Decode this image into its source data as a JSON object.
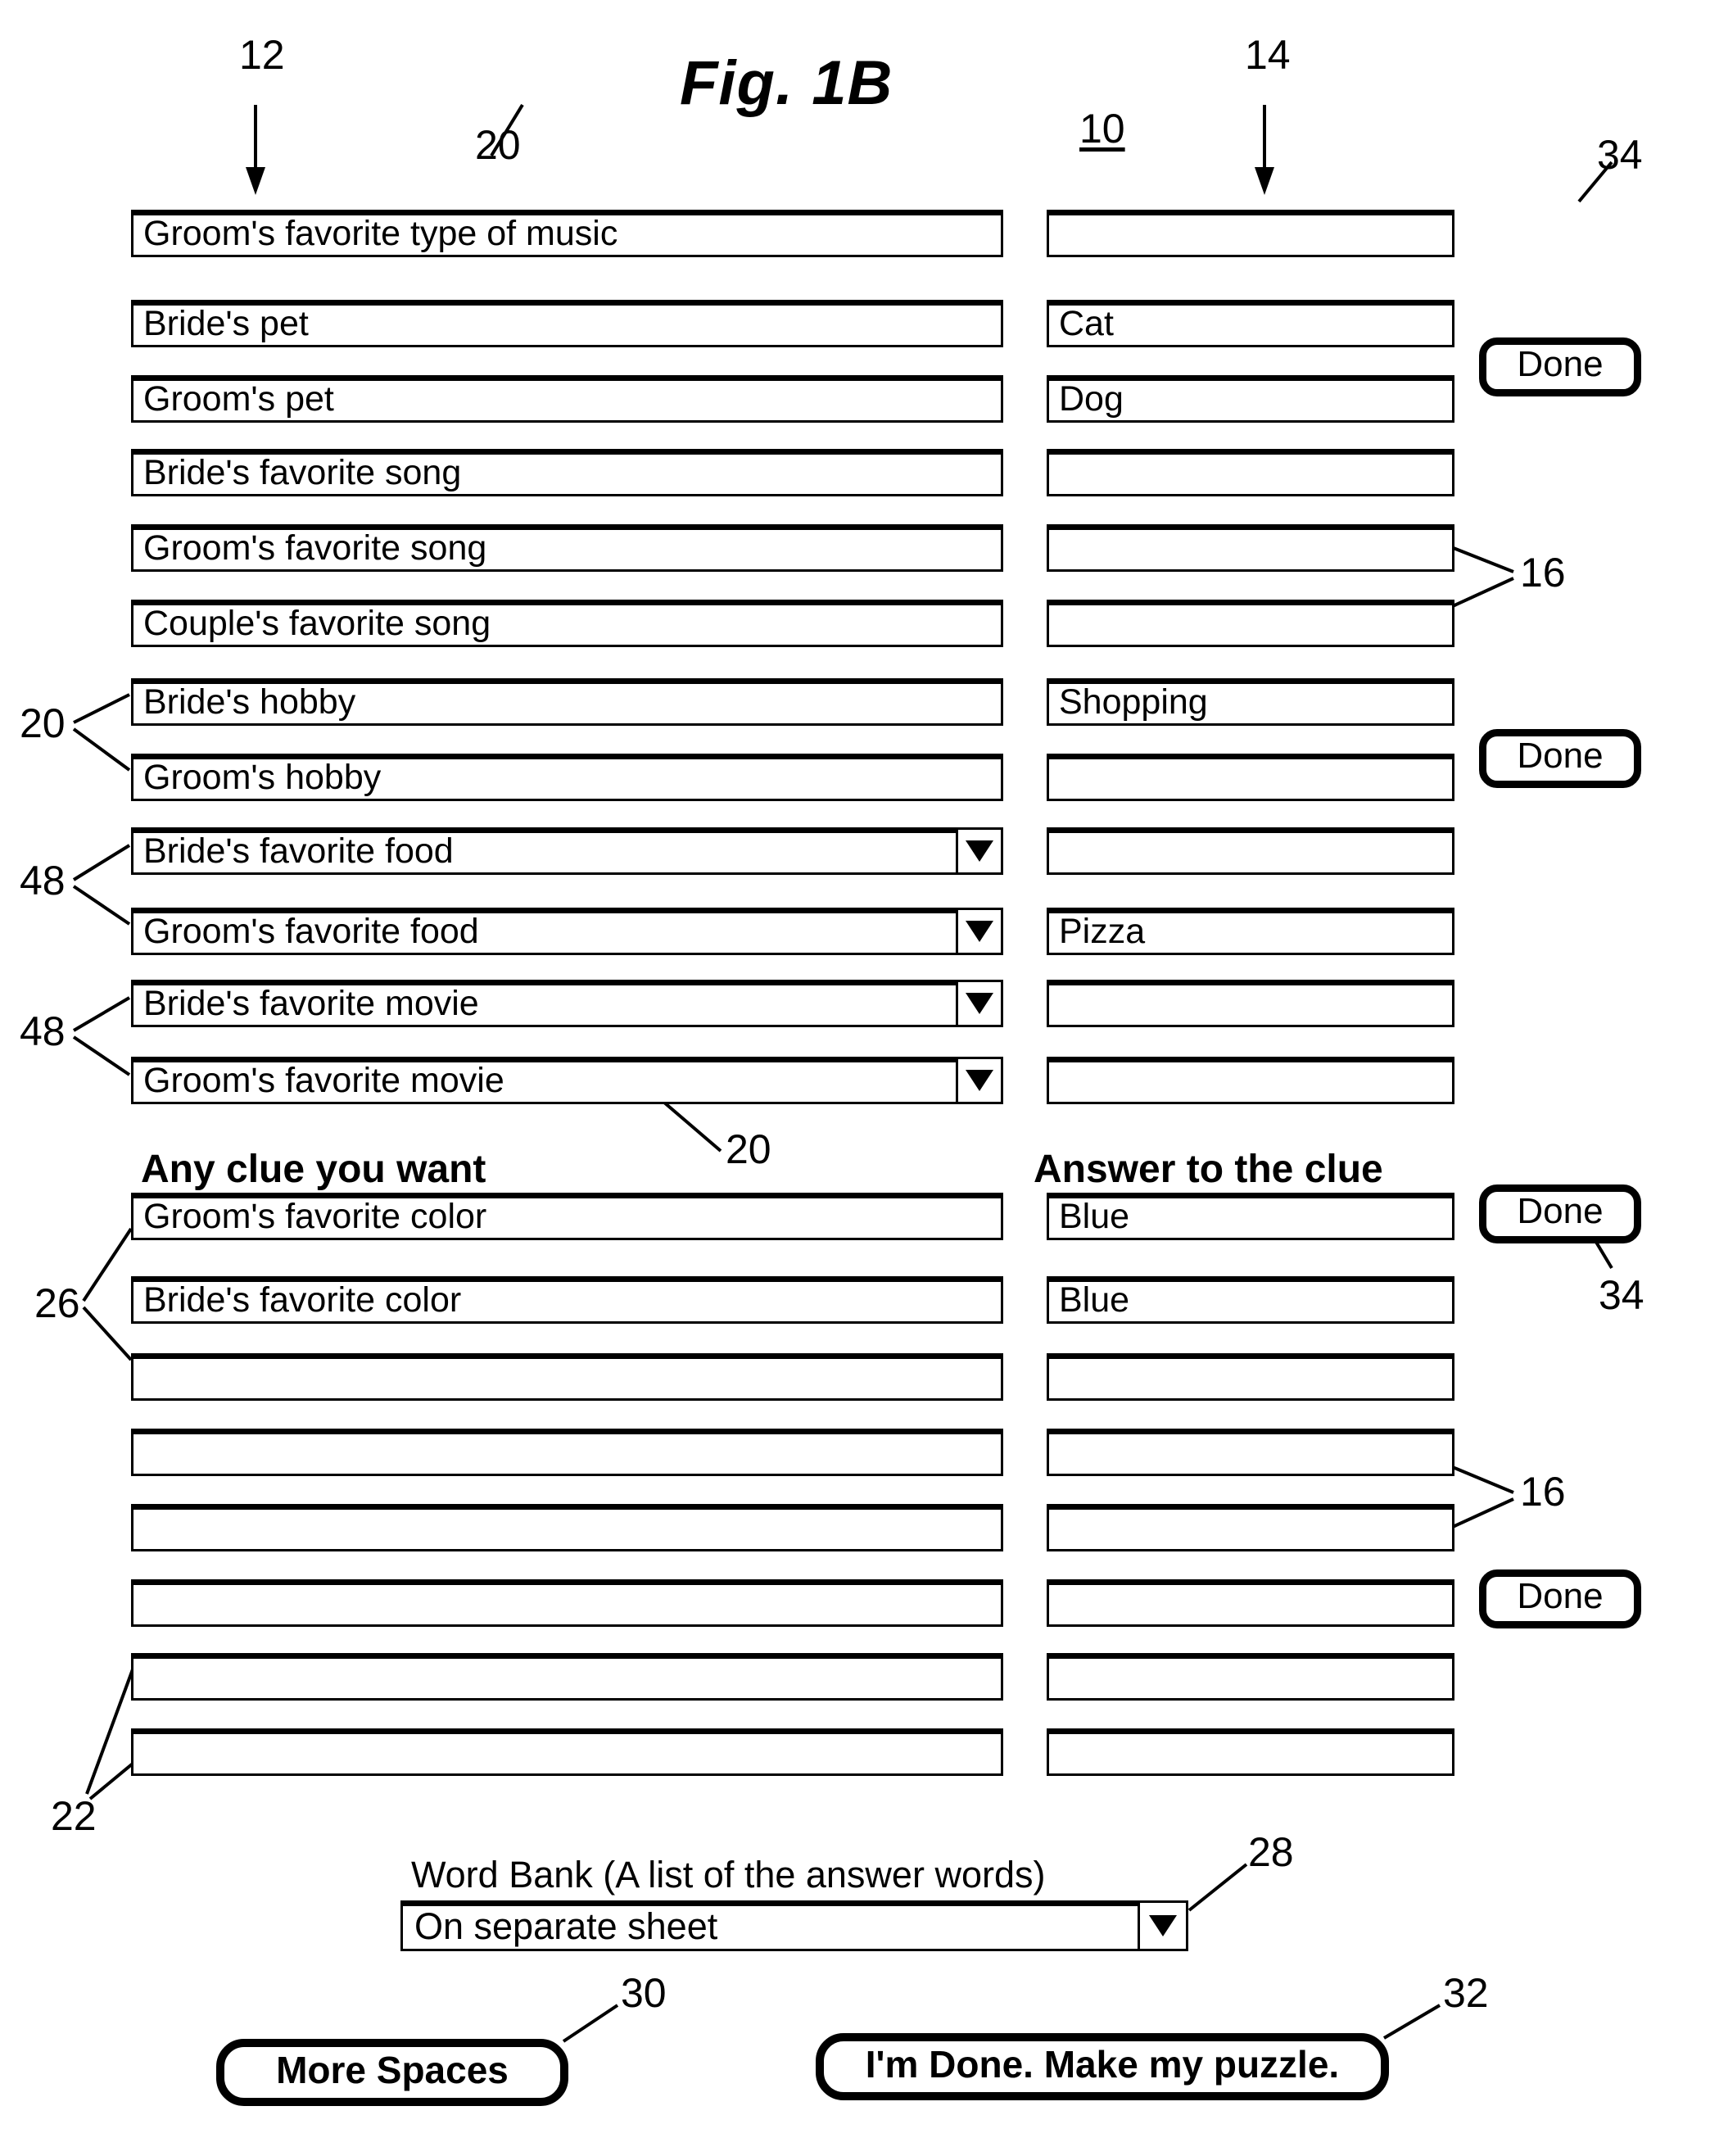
{
  "figure": {
    "title": "Fig. 1B"
  },
  "reference_numerals": {
    "n10": "10",
    "n12": "12",
    "n14": "14",
    "n16_a": "16",
    "n16_b": "16",
    "n20_a": "20",
    "n20_b": "20",
    "n20_c": "20",
    "n22": "22",
    "n26": "26",
    "n28": "28",
    "n30": "30",
    "n32": "32",
    "n34_a": "34",
    "n34_b": "34",
    "n48_a": "48",
    "n48_b": "48"
  },
  "section_headings": {
    "clue_column": "Any clue you want",
    "answer_column": "Answer to the clue"
  },
  "rows": [
    {
      "clue": "Groom's favorite type of music",
      "answer": "",
      "dropdown": false
    },
    {
      "clue": "Bride's pet",
      "answer": "Cat",
      "dropdown": false
    },
    {
      "clue": "Groom's pet",
      "answer": "Dog",
      "dropdown": false
    },
    {
      "clue": "Bride's favorite song",
      "answer": "",
      "dropdown": false
    },
    {
      "clue": "Groom's favorite song",
      "answer": "",
      "dropdown": false
    },
    {
      "clue": "Couple's favorite song",
      "answer": "",
      "dropdown": false
    },
    {
      "clue": "Bride's hobby",
      "answer": "Shopping",
      "dropdown": false
    },
    {
      "clue": "Groom's hobby",
      "answer": "",
      "dropdown": false
    },
    {
      "clue": "Bride's favorite food",
      "answer": "",
      "dropdown": true
    },
    {
      "clue": "Groom's favorite food",
      "answer": "Pizza",
      "dropdown": true
    },
    {
      "clue": "Bride's favorite movie",
      "answer": "",
      "dropdown": true
    },
    {
      "clue": "Groom's favorite movie",
      "answer": "",
      "dropdown": true
    },
    {
      "clue": "Groom's favorite color",
      "answer": "Blue",
      "dropdown": false
    },
    {
      "clue": "Bride's favorite color",
      "answer": "Blue",
      "dropdown": false
    },
    {
      "clue": "",
      "answer": "",
      "dropdown": false
    },
    {
      "clue": "",
      "answer": "",
      "dropdown": false
    },
    {
      "clue": "",
      "answer": "",
      "dropdown": false
    },
    {
      "clue": "",
      "answer": "",
      "dropdown": false
    },
    {
      "clue": "",
      "answer": "",
      "dropdown": false
    },
    {
      "clue": "",
      "answer": "",
      "dropdown": false
    }
  ],
  "done_buttons": {
    "label": "Done",
    "count": 4
  },
  "word_bank": {
    "label": "Word Bank (A list of the answer words)",
    "value": "On separate sheet"
  },
  "bottom_buttons": {
    "more_spaces": "More Spaces",
    "make_puzzle": "I'm Done.  Make my puzzle."
  },
  "icons": {
    "dropdown": "chevron-down-icon"
  }
}
